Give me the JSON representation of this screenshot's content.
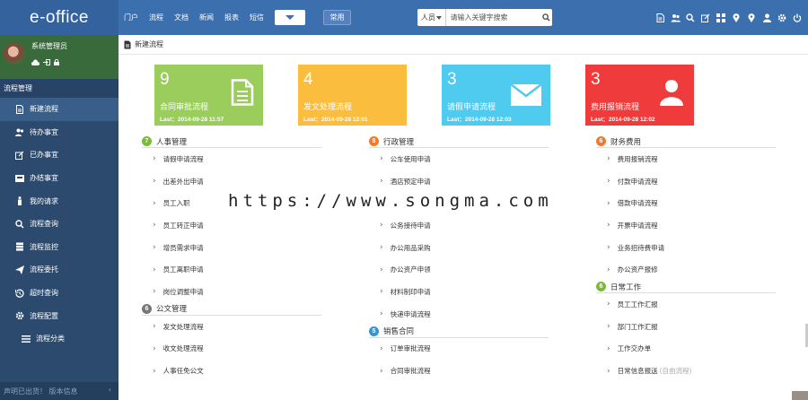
{
  "app": {
    "logo": "e-office",
    "nav": [
      "门户",
      "流程",
      "文档",
      "新闻",
      "报表",
      "短信"
    ],
    "common_btn": "常用",
    "search_type": "人员",
    "search_placeholder": "请输入关键字搜索",
    "top_icons": [
      "doc-icon",
      "users-icon",
      "search-icon",
      "edit-icon",
      "grid-icon",
      "location-icon",
      "location-icon",
      "user-icon",
      "gear-icon",
      "power-icon"
    ]
  },
  "sidebar": {
    "user": "系统管理员",
    "section": "流程管理",
    "items": [
      "新建流程",
      "待办事宜",
      "已办事宜",
      "办结事宜",
      "我的请求",
      "流程查询",
      "流程监控",
      "流程委托",
      "超时查询",
      "流程配置"
    ],
    "sub_items": [
      "流程分类"
    ],
    "footer": "声明已出货！   版本信息"
  },
  "main": {
    "title": "新建流程",
    "tiles": [
      {
        "num": "9",
        "name": "合同审批流程",
        "date": "Last：2014-09-28 11:57",
        "color": "#9acd5b",
        "icon": "document-icon"
      },
      {
        "num": "4",
        "name": "发文处理流程",
        "date": "Last：2014-09-28 12:01",
        "color": "#fbbd3d",
        "icon": "none"
      },
      {
        "num": "3",
        "name": "请假申请流程",
        "date": "Last：2014-09-28 12:03",
        "color": "#4fcbef",
        "icon": "envelope-icon"
      },
      {
        "num": "3",
        "name": "费用报销流程",
        "date": "Last：2014-09-28 12:02",
        "color": "#ef3b3b",
        "icon": "user-icon"
      }
    ],
    "sections": [
      {
        "num": "7",
        "color": "#7cbb3a",
        "title": "人事管理",
        "links": [
          "请假申请流程",
          "出差外出申请",
          "员工入职",
          "员工转正申请",
          "增员需求申请",
          "员工离职申请",
          "岗位调整申请"
        ]
      },
      {
        "num": "6",
        "color": "#777777",
        "title": "公文管理",
        "links": [
          "发文处理流程",
          "收文处理流程",
          "人事任免公文"
        ]
      },
      {
        "num": "8",
        "color": "#f07a2c",
        "title": "行政管理",
        "links": [
          "公车使用申请",
          "酒店预定申请",
          "",
          "公务接待申请",
          "办公用品采购",
          "办公资产申领",
          "材料制印申请",
          "快递申请流程"
        ]
      },
      {
        "num": "5",
        "color": "#3a93d8",
        "title": "销售合同",
        "links": [
          "订单审批流程",
          "合同审批流程"
        ]
      },
      {
        "num": "6",
        "color": "#f07a2c",
        "title": "财务费用",
        "links": [
          "费用报销流程",
          "付款申请流程",
          "借款申请流程",
          "开票申请流程",
          "业务招待费申请",
          "办公资产报修"
        ]
      },
      {
        "num": "6",
        "color": "#7cbb3a",
        "title": "日常工作",
        "links": [
          "员工工作汇报",
          "部门工作汇报",
          "工作交办单",
          "日常信息报送"
        ]
      }
    ],
    "daily_hint": "(自由流程)",
    "watermark": "https://www.songma.com"
  }
}
